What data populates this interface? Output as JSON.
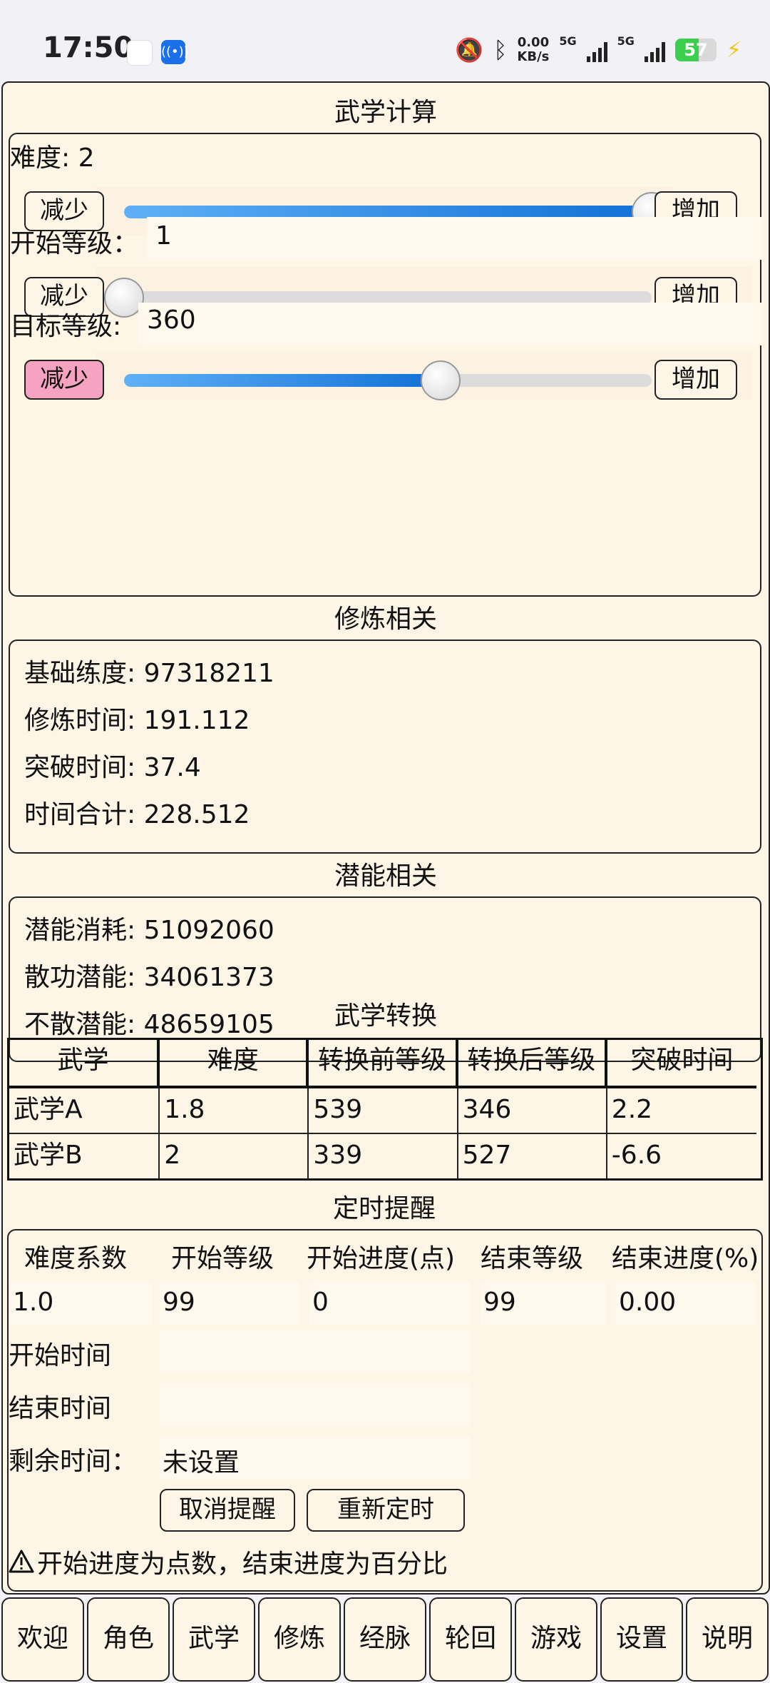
{
  "status_bar": {
    "time": "17:50",
    "net_speed": "0.00",
    "net_unit": "KB/s",
    "sim1": "5G",
    "sim2": "5G",
    "battery": "57",
    "battery_fraction": 0.57,
    "icons": [
      "bubble-icon",
      "broadcast-icon",
      "bell-mute-icon",
      "bluetooth-icon",
      "signal-icon",
      "battery-icon",
      "charging-icon"
    ]
  },
  "calc": {
    "title": "武学计算",
    "difficulty_label": "难度: 2",
    "start_level_label": "开始等级：",
    "start_level_value": "1",
    "target_level_label": "目标等级:",
    "target_level_value": "360",
    "decrease": "减少",
    "increase": "增加",
    "slider_difficulty_fraction": 1.0,
    "slider_start_fraction": 0.0,
    "slider_target_fraction": 0.6,
    "highlight_color": "#f5a3c0"
  },
  "training": {
    "title": "修炼相关",
    "lines": [
      "基础练度: 97318211",
      "修炼时间: 191.112",
      "突破时间: 37.4",
      "时间合计: 228.512"
    ]
  },
  "potential": {
    "title": "潜能相关",
    "lines": [
      "潜能消耗: 51092060",
      "散功潜能: 34061373",
      "不散潜能: 48659105"
    ]
  },
  "conversion": {
    "title": "武学转换",
    "headers": [
      "武学",
      "难度",
      "转换前等级",
      "转换后等级",
      "突破时间"
    ],
    "rows": [
      [
        "武学A",
        "1.8",
        "539",
        "346",
        "2.2"
      ],
      [
        "武学B",
        "2",
        "339",
        "527",
        "-6.6"
      ]
    ]
  },
  "timer": {
    "title": "定时提醒",
    "headers": [
      "难度系数",
      "开始等级",
      "开始进度(点)",
      "结束等级",
      "结束进度(%)"
    ],
    "values": [
      "1.0",
      "99",
      "0",
      "99",
      "0.00"
    ],
    "start_time_label": "开始时间",
    "start_time_value": "",
    "end_time_label": "结束时间",
    "end_time_value": "",
    "remaining_label": "剩余时间：",
    "remaining_value": "未设置",
    "cancel_button": "取消提醒",
    "reset_button": "重新定时",
    "note": "开始进度为点数，结束进度为百分比"
  },
  "nav": {
    "items": [
      "欢迎",
      "角色",
      "武学",
      "修炼",
      "经脉",
      "轮回",
      "游戏",
      "设置",
      "说明"
    ]
  },
  "colors": {
    "app_bg": "#fdf5e6",
    "slider_fill": "#1270d6",
    "battery_green": "#3ccf4e"
  }
}
